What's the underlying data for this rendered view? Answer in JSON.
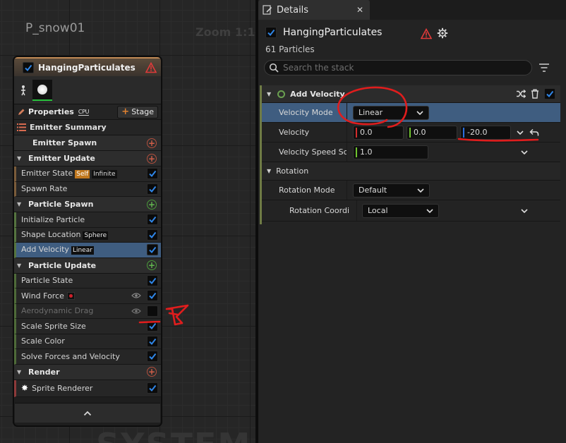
{
  "graph": {
    "title": "P_snow01",
    "zoom": "Zoom 1:1",
    "watermark": "SYSTEM"
  },
  "node": {
    "title": "HangingParticulates",
    "properties_label": "Properties",
    "sim_target": "CPU",
    "stage_label": "Stage",
    "emitter_summary": "Emitter Summary",
    "groups": {
      "emitter_spawn": "Emitter Spawn",
      "emitter_update": "Emitter Update",
      "particle_spawn": "Particle Spawn",
      "particle_update": "Particle Update",
      "render": "Render"
    },
    "modules": {
      "emitter_state": {
        "label": "Emitter State",
        "tag1": "Self",
        "tag2": "Infinite",
        "enabled": true
      },
      "spawn_rate": {
        "label": "Spawn Rate",
        "enabled": true
      },
      "initialize_particle": {
        "label": "Initialize Particle",
        "enabled": true
      },
      "shape_location": {
        "label": "Shape Location",
        "tag": "Sphere",
        "enabled": true
      },
      "add_velocity": {
        "label": "Add Velocity",
        "tag": "Linear",
        "enabled": true,
        "selected": true
      },
      "particle_state": {
        "label": "Particle State",
        "enabled": true
      },
      "wind_force": {
        "label": "Wind Force",
        "enabled": true
      },
      "aerodynamic_drag": {
        "label": "Aerodynamic Drag",
        "enabled": false
      },
      "scale_sprite_size": {
        "label": "Scale Sprite Size",
        "enabled": true
      },
      "scale_color": {
        "label": "Scale Color",
        "enabled": true
      },
      "solve_forces": {
        "label": "Solve Forces and Velocity",
        "enabled": true
      },
      "sprite_renderer": {
        "label": "Sprite Renderer",
        "enabled": true
      }
    }
  },
  "details": {
    "tab_label": "Details",
    "emitter_name": "HangingParticulates",
    "particle_count": "61 Particles",
    "search_placeholder": "Search the stack",
    "module": {
      "name": "Add Velocity",
      "velocity_mode": {
        "label": "Velocity Mode",
        "value": "Linear"
      },
      "velocity": {
        "label": "Velocity",
        "x": "0.0",
        "y": "0.0",
        "z": "-20.0"
      },
      "velocity_speed_scale": {
        "label": "Velocity Speed Sc",
        "value": "1.0"
      },
      "rotation": {
        "label": "Rotation",
        "mode": {
          "label": "Rotation Mode",
          "value": "Default"
        },
        "coordinate": {
          "label": "Rotation Coordi",
          "value": "Local"
        }
      }
    }
  },
  "colors": {
    "accent_selected": "#3f5d80",
    "checkbox_blue": "#2f86e8",
    "warning_red": "#e03a3a",
    "annotation_red": "#e01d1d"
  }
}
